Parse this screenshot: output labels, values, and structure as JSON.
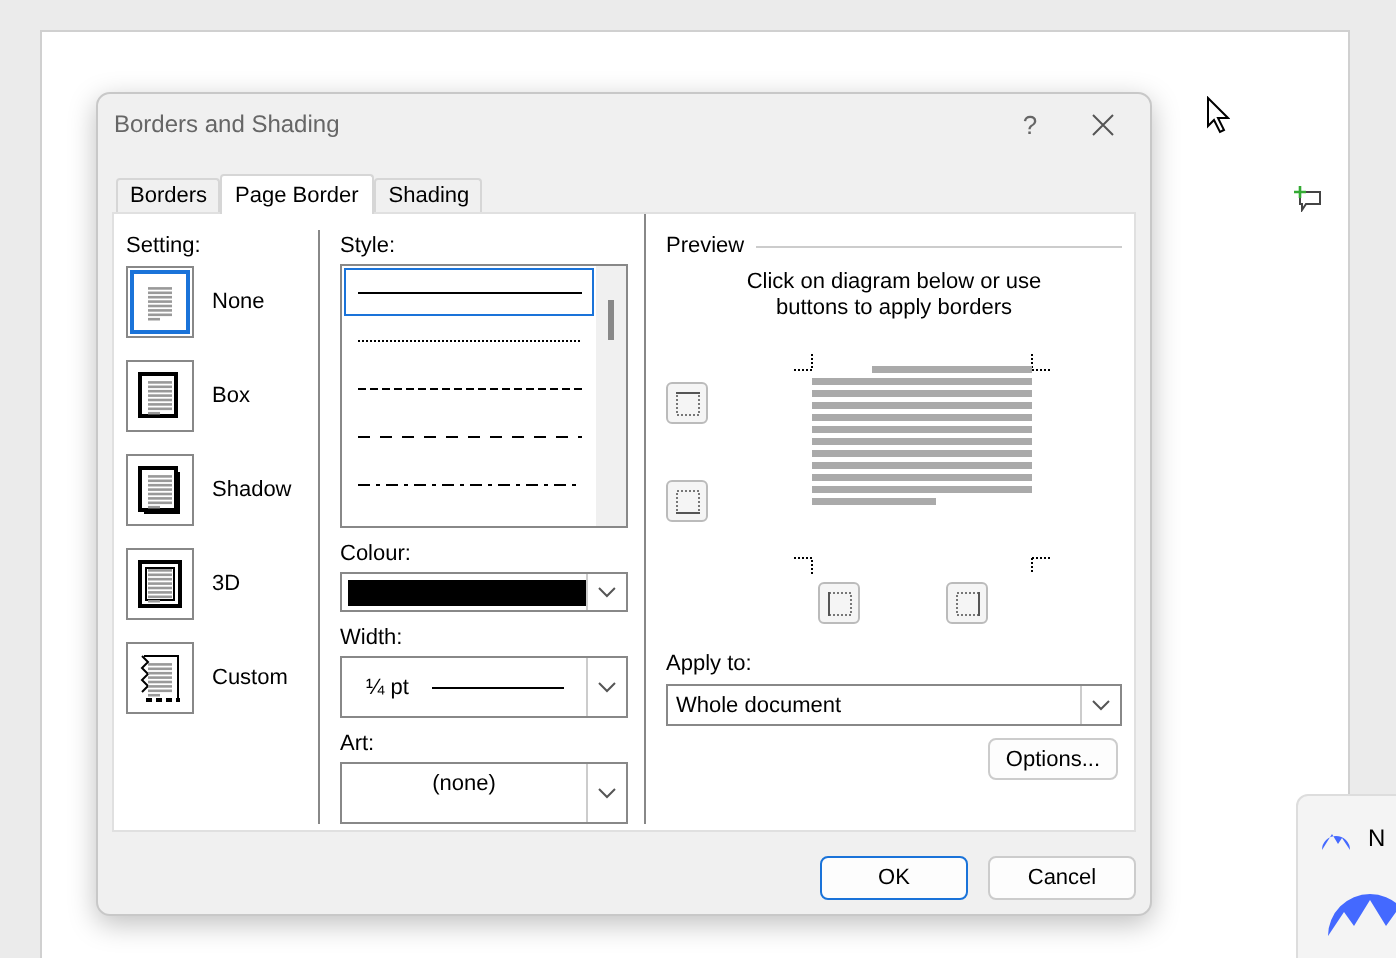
{
  "window": {
    "title": "Borders and Shading",
    "help": "?"
  },
  "tabs": [
    {
      "label": "Borders",
      "selected": false
    },
    {
      "label": "Page Border",
      "selected": true
    },
    {
      "label": "Shading",
      "selected": false
    }
  ],
  "setting": {
    "label": "Setting:",
    "items": [
      {
        "label": "None",
        "kind": "none",
        "selected": true
      },
      {
        "label": "Box",
        "kind": "box",
        "selected": false
      },
      {
        "label": "Shadow",
        "kind": "shadow",
        "selected": false
      },
      {
        "label": "3D",
        "kind": "framed",
        "selected": false
      },
      {
        "label": "Custom",
        "kind": "custom",
        "selected": false
      }
    ]
  },
  "style": {
    "label": "Style:",
    "items": [
      {
        "kind": "solid",
        "selected": true
      },
      {
        "kind": "dotted",
        "selected": false
      },
      {
        "kind": "dashed",
        "selected": false
      },
      {
        "kind": "dashed-wide",
        "selected": false
      },
      {
        "kind": "dash-dot",
        "selected": false
      }
    ]
  },
  "colour": {
    "label": "Colour:",
    "color": "#000000"
  },
  "width": {
    "label": "Width:",
    "value": "¼ pt"
  },
  "art": {
    "label": "Art:",
    "value": "(none)"
  },
  "preview": {
    "title": "Preview",
    "instructions": "Click on diagram below or use buttons to apply borders"
  },
  "apply_to": {
    "label": "Apply to:",
    "value": "Whole document"
  },
  "buttons": {
    "options": "Options...",
    "ok": "OK",
    "cancel": "Cancel"
  },
  "toast": {
    "title": "N"
  }
}
